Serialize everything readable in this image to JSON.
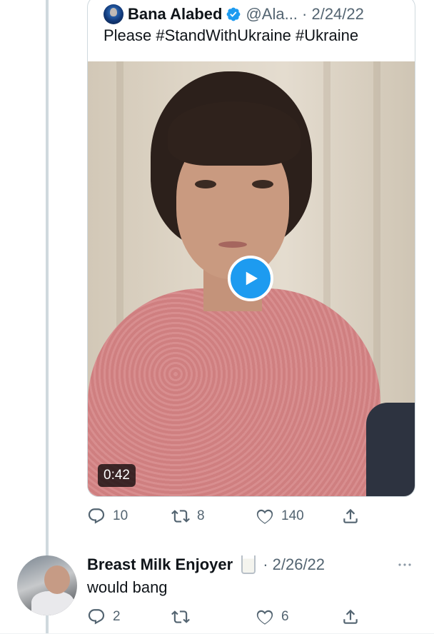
{
  "quoted_tweet": {
    "author_name": "Bana Alabed",
    "handle_and_date": "@Ala... · 2/24/22",
    "text": "Please  #StandWithUkraine #Ukraine",
    "video_duration": "0:42"
  },
  "quoted_actions": {
    "reply_count": "10",
    "retweet_count": "8",
    "like_count": "140"
  },
  "reply_tweet": {
    "author_name": "Breast Milk Enjoyer",
    "date": "· 2/26/22",
    "text": "would bang",
    "reply_count": "2",
    "retweet_count": "",
    "like_count": "6"
  },
  "colors": {
    "accent": "#1d9bf0",
    "secondary_text": "#536471",
    "thread_line": "#cfd9de"
  },
  "icons": [
    "verified-badge-icon",
    "play-icon",
    "reply-icon",
    "retweet-icon",
    "like-icon",
    "share-icon",
    "more-icon",
    "milk-glass-emoji"
  ]
}
